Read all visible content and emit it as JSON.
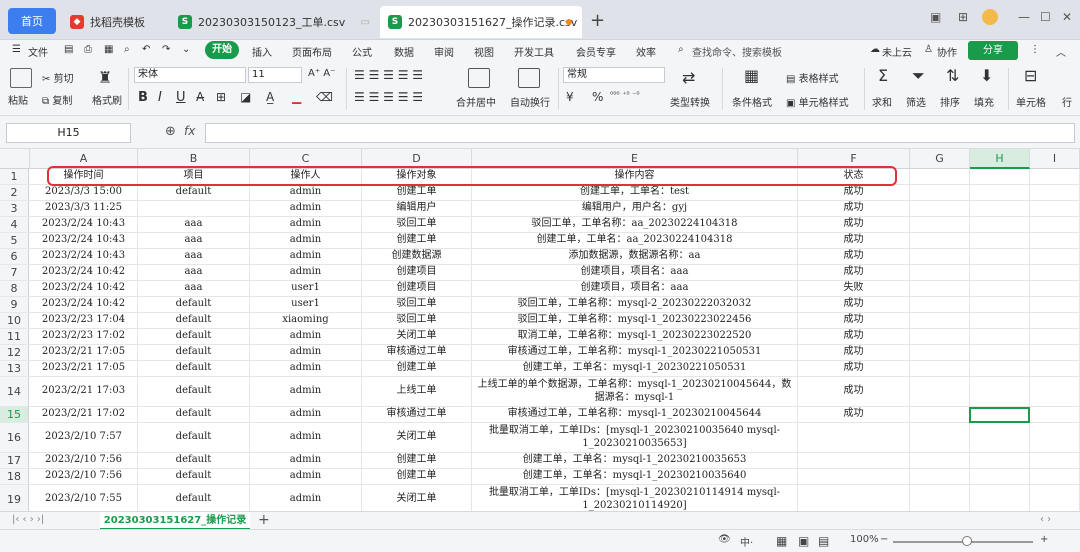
{
  "tabs": {
    "home": "首页",
    "items": [
      {
        "label": "找稻壳模板",
        "icon": "docer-icon",
        "color": "#e33b2e"
      },
      {
        "label": "20230303150123_工单.csv",
        "icon": "sheet-icon",
        "color": "#1a9b4c"
      },
      {
        "label": "20230303151627_操作记录.csv",
        "icon": "sheet-icon",
        "color": "#1a9b4c"
      }
    ],
    "new_tab": "+"
  },
  "menubar": {
    "file": "文件",
    "start": "开始",
    "items": [
      "插入",
      "页面布局",
      "公式",
      "数据",
      "审阅",
      "视图",
      "开发工具",
      "会员专享",
      "效率"
    ],
    "search": "查找命令、搜索模板",
    "cloud": "未上云",
    "collab": "协作",
    "share": "分享"
  },
  "ribbon": {
    "paste": "粘贴",
    "cut": "剪切",
    "copy": "复制",
    "format_painter": "格式刷",
    "font": "宋体",
    "font_size": "11",
    "bold": "B",
    "italic": "I",
    "underline": "U",
    "merge": "合并居中",
    "wrap": "自动换行",
    "number_format": "常规",
    "currency": "¥",
    "percent": "%",
    "type_convert": "类型转换",
    "cond_format": "条件格式",
    "table_style": "表格样式",
    "cell_style": "单元格样式",
    "sum": "求和",
    "filter": "筛选",
    "sort": "排序",
    "fill": "填充",
    "cell": "单元格",
    "row": "行"
  },
  "formula_bar": {
    "cell_ref": "H15",
    "fx": "fx",
    "value": ""
  },
  "grid": {
    "columns": [
      "A",
      "B",
      "C",
      "D",
      "E",
      "F",
      "G",
      "H",
      "I"
    ],
    "selected_column": "H",
    "selected_row": "15",
    "rows": [
      {
        "n": "1",
        "cells": [
          "操作时间",
          "项目",
          "操作人",
          "操作对象",
          "操作内容",
          "状态"
        ]
      },
      {
        "n": "2",
        "cells": [
          "2023/3/3 15:00",
          "default",
          "admin",
          "创建工单",
          "创建工单，工单名：test",
          "成功"
        ]
      },
      {
        "n": "3",
        "cells": [
          "2023/3/3 11:25",
          "",
          "admin",
          "编辑用户",
          "编辑用户，用户名：gyj",
          "成功"
        ]
      },
      {
        "n": "4",
        "cells": [
          "2023/2/24 10:43",
          "aaa",
          "admin",
          "驳回工单",
          "驳回工单，工单名称：aa_20230224104318",
          "成功"
        ]
      },
      {
        "n": "5",
        "cells": [
          "2023/2/24 10:43",
          "aaa",
          "admin",
          "创建工单",
          "创建工单，工单名：aa_20230224104318",
          "成功"
        ]
      },
      {
        "n": "6",
        "cells": [
          "2023/2/24 10:43",
          "aaa",
          "admin",
          "创建数据源",
          "添加数据源，数据源名称：aa",
          "成功"
        ]
      },
      {
        "n": "7",
        "cells": [
          "2023/2/24 10:42",
          "aaa",
          "admin",
          "创建项目",
          "创建项目，项目名：aaa",
          "成功"
        ]
      },
      {
        "n": "8",
        "cells": [
          "2023/2/24 10:42",
          "aaa",
          "user1",
          "创建项目",
          "创建项目，项目名：aaa",
          "失败"
        ]
      },
      {
        "n": "9",
        "cells": [
          "2023/2/24 10:42",
          "default",
          "user1",
          "驳回工单",
          "驳回工单，工单名称：mysql-2_20230222032032",
          "成功"
        ]
      },
      {
        "n": "10",
        "cells": [
          "2023/2/23 17:04",
          "default",
          "xiaoming",
          "驳回工单",
          "驳回工单，工单名称：mysql-1_20230223022456",
          "成功"
        ]
      },
      {
        "n": "11",
        "cells": [
          "2023/2/23 17:02",
          "default",
          "admin",
          "关闭工单",
          "取消工单，工单名称：mysql-1_20230223022520",
          "成功"
        ]
      },
      {
        "n": "12",
        "cells": [
          "2023/2/21 17:05",
          "default",
          "admin",
          "审核通过工单",
          "审核通过工单，工单名称：mysql-1_20230221050531",
          "成功"
        ]
      },
      {
        "n": "13",
        "cells": [
          "2023/2/21 17:05",
          "default",
          "admin",
          "创建工单",
          "创建工单，工单名：mysql-1_20230221050531",
          "成功"
        ]
      },
      {
        "n": "14",
        "cells": [
          "2023/2/21 17:03",
          "default",
          "admin",
          "上线工单",
          "上线工单的单个数据源，工单名称：mysql-1_20230210045644，数据源名：mysql-1",
          "成功"
        ]
      },
      {
        "n": "15",
        "cells": [
          "2023/2/21 17:02",
          "default",
          "admin",
          "审核通过工单",
          "审核通过工单，工单名称：mysql-1_20230210045644",
          "成功"
        ]
      },
      {
        "n": "16",
        "cells": [
          "2023/2/10 7:57",
          "default",
          "admin",
          "关闭工单",
          "批量取消工单，工单IDs：[mysql-1_20230210035640 mysql-1_20230210035653]",
          ""
        ]
      },
      {
        "n": "17",
        "cells": [
          "2023/2/10 7:56",
          "default",
          "admin",
          "创建工单",
          "创建工单，工单名：mysql-1_20230210035653",
          ""
        ]
      },
      {
        "n": "18",
        "cells": [
          "2023/2/10 7:56",
          "default",
          "admin",
          "创建工单",
          "创建工单，工单名：mysql-1_20230210035640",
          ""
        ]
      },
      {
        "n": "19",
        "cells": [
          "2023/2/10 7:55",
          "default",
          "admin",
          "关闭工单",
          "批量取消工单，工单IDs：[mysql-1_20230210114914 mysql-1_20230210114920]",
          ""
        ]
      }
    ]
  },
  "sheet_tabs": {
    "active": "20230303151627_操作记录",
    "add": "+"
  },
  "status": {
    "zoom": "100%",
    "zoom_minus": "−",
    "zoom_plus": "+"
  }
}
